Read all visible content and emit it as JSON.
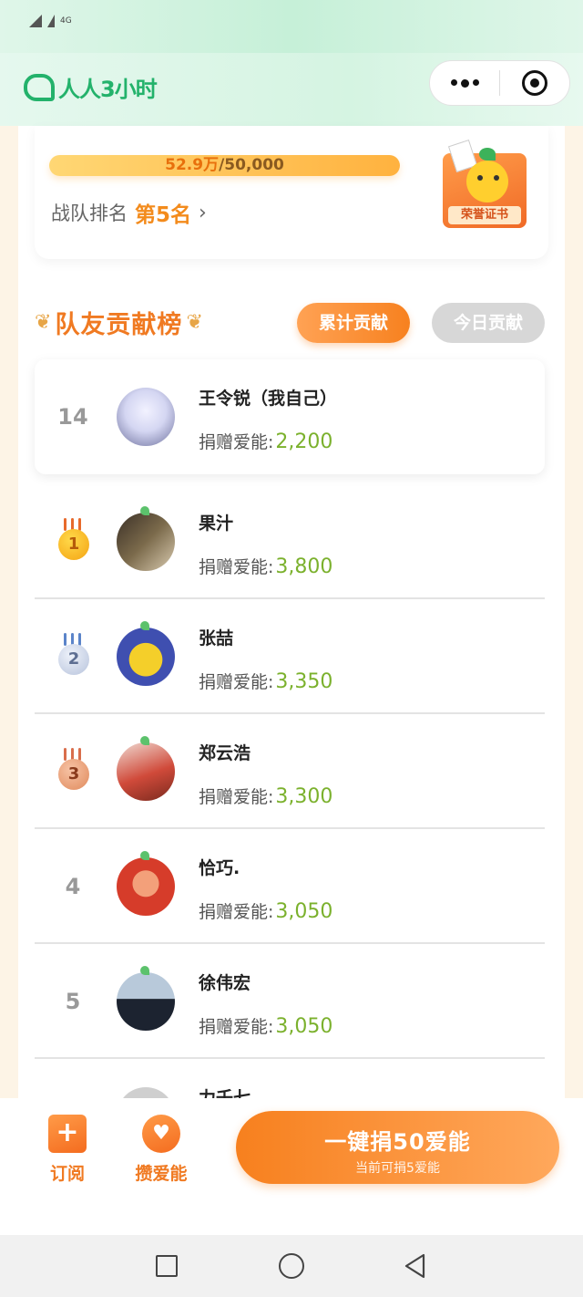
{
  "status_bar": {
    "network": "4G"
  },
  "header": {
    "app_name": "人人3小时"
  },
  "team_card": {
    "progress_current": "52.9万",
    "progress_target": "/50,000",
    "progress_fraction": 1.0,
    "rank_label": "战队排名",
    "rank_value": "第5名",
    "badge_text": "荣誉证书"
  },
  "board": {
    "title": "队友贡献榜",
    "tabs": [
      {
        "label": "累计贡献",
        "active": true
      },
      {
        "label": "今日贡献",
        "active": false
      }
    ],
    "donate_label": "捐赠爱能:",
    "me": {
      "rank": "14",
      "name": "王令锐（我自己）",
      "amount": "2,200"
    },
    "rows": [
      {
        "rank": "1",
        "name": "果汁",
        "amount": "3,800",
        "medal": "gold"
      },
      {
        "rank": "2",
        "name": "张喆",
        "amount": "3,350",
        "medal": "silver"
      },
      {
        "rank": "3",
        "name": "郑云浩",
        "amount": "3,300",
        "medal": "bronze"
      },
      {
        "rank": "4",
        "name": "恰巧.",
        "amount": "3,050"
      },
      {
        "rank": "5",
        "name": "徐伟宏",
        "amount": "3,050"
      },
      {
        "rank": "",
        "name": "力壬七",
        "amount": ""
      }
    ]
  },
  "bottom_bar": {
    "subscribe_label": "订阅",
    "save_label": "攒爱能",
    "donate_main": "一键捐50爱能",
    "donate_sub": "当前可捐5爱能"
  },
  "colors": {
    "accent": "#f7811f",
    "brand": "#23b26b",
    "amount": "#7bb12d"
  }
}
